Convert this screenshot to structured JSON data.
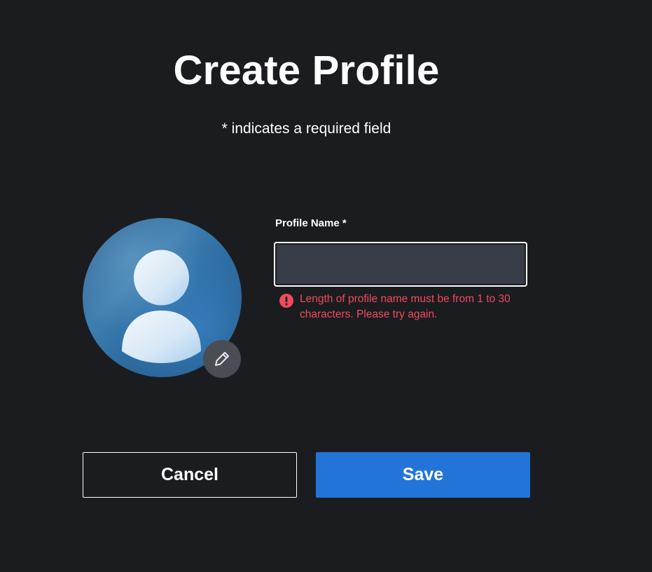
{
  "header": {
    "title": "Create Profile",
    "required_note": "* indicates a required field"
  },
  "avatar": {
    "icon": "user-silhouette-icon",
    "edit_icon": "pencil-icon"
  },
  "profile_name": {
    "label": "Profile Name *",
    "value": "",
    "error_icon": "exclamation-circle-icon",
    "error": "Length of profile name must be from 1 to 30 characters. Please try again."
  },
  "actions": {
    "cancel_label": "Cancel",
    "save_label": "Save"
  },
  "colors": {
    "background": "#1b1c20",
    "input_background": "#383c46",
    "error": "#f04a5e",
    "primary": "#2374d8",
    "edit_button": "#4a4d53"
  }
}
